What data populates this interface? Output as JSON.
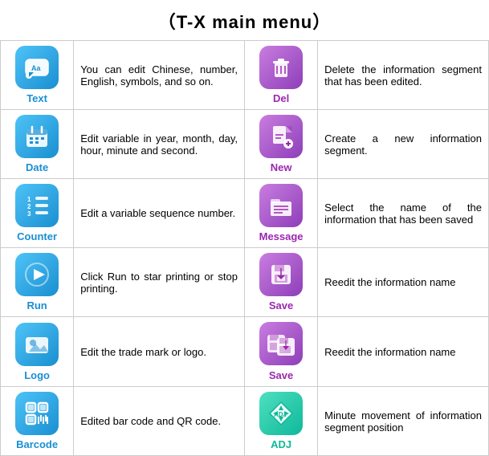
{
  "title": "（T-X main menu）",
  "rows": [
    {
      "left": {
        "icon_name": "text-icon",
        "label": "Text",
        "label_class": "label-blue",
        "bg_class": "bg-blue",
        "icon_type": "chat"
      },
      "left_desc": "You can edit Chinese, number, English, symbols, and so on.",
      "right": {
        "icon_name": "del-icon",
        "label": "Del",
        "label_class": "label-purple",
        "bg_class": "bg-purple",
        "icon_type": "trash"
      },
      "right_desc": "Delete the information segment that has been edited."
    },
    {
      "left": {
        "icon_name": "date-icon",
        "label": "Date",
        "label_class": "label-blue",
        "bg_class": "bg-blue",
        "icon_type": "calendar"
      },
      "left_desc": "Edit variable in year, month, day, hour, minute and second.",
      "right": {
        "icon_name": "new-icon",
        "label": "New",
        "label_class": "label-purple",
        "bg_class": "bg-purple",
        "icon_type": "new-doc"
      },
      "right_desc": "Create a new information segment."
    },
    {
      "left": {
        "icon_name": "counter-icon",
        "label": "Counter",
        "label_class": "label-blue",
        "bg_class": "bg-blue",
        "icon_type": "counter"
      },
      "left_desc": "Edit a variable sequence number.",
      "right": {
        "icon_name": "message-icon",
        "label": "Message",
        "label_class": "label-purple",
        "bg_class": "bg-purple",
        "icon_type": "message"
      },
      "right_desc": "Select the name of the information that has been saved"
    },
    {
      "left": {
        "icon_name": "run-icon",
        "label": "Run",
        "label_class": "label-blue",
        "bg_class": "bg-blue",
        "icon_type": "play"
      },
      "left_desc": "Click Run to star printing or stop printing.",
      "right": {
        "icon_name": "save-icon-1",
        "label": "Save",
        "label_class": "label-purple",
        "bg_class": "bg-purple",
        "icon_type": "save"
      },
      "right_desc": "Reedit the information name"
    },
    {
      "left": {
        "icon_name": "logo-icon",
        "label": "Logo",
        "label_class": "label-blue",
        "bg_class": "bg-blue",
        "icon_type": "image"
      },
      "left_desc": "Edit the trade mark or logo.",
      "right": {
        "icon_name": "save-icon-2",
        "label": "Save",
        "label_class": "label-purple",
        "bg_class": "bg-purple",
        "icon_type": "save2"
      },
      "right_desc": "Reedit the information name"
    },
    {
      "left": {
        "icon_name": "barcode-icon",
        "label": "Barcode",
        "label_class": "label-blue",
        "bg_class": "bg-blue",
        "icon_type": "barcode"
      },
      "left_desc": "Edited bar code and QR code.",
      "right": {
        "icon_name": "adj-icon",
        "label": "ADJ",
        "label_class": "label-teal",
        "bg_class": "bg-teal",
        "icon_type": "adj"
      },
      "right_desc": "Minute movement of information segment position"
    }
  ]
}
